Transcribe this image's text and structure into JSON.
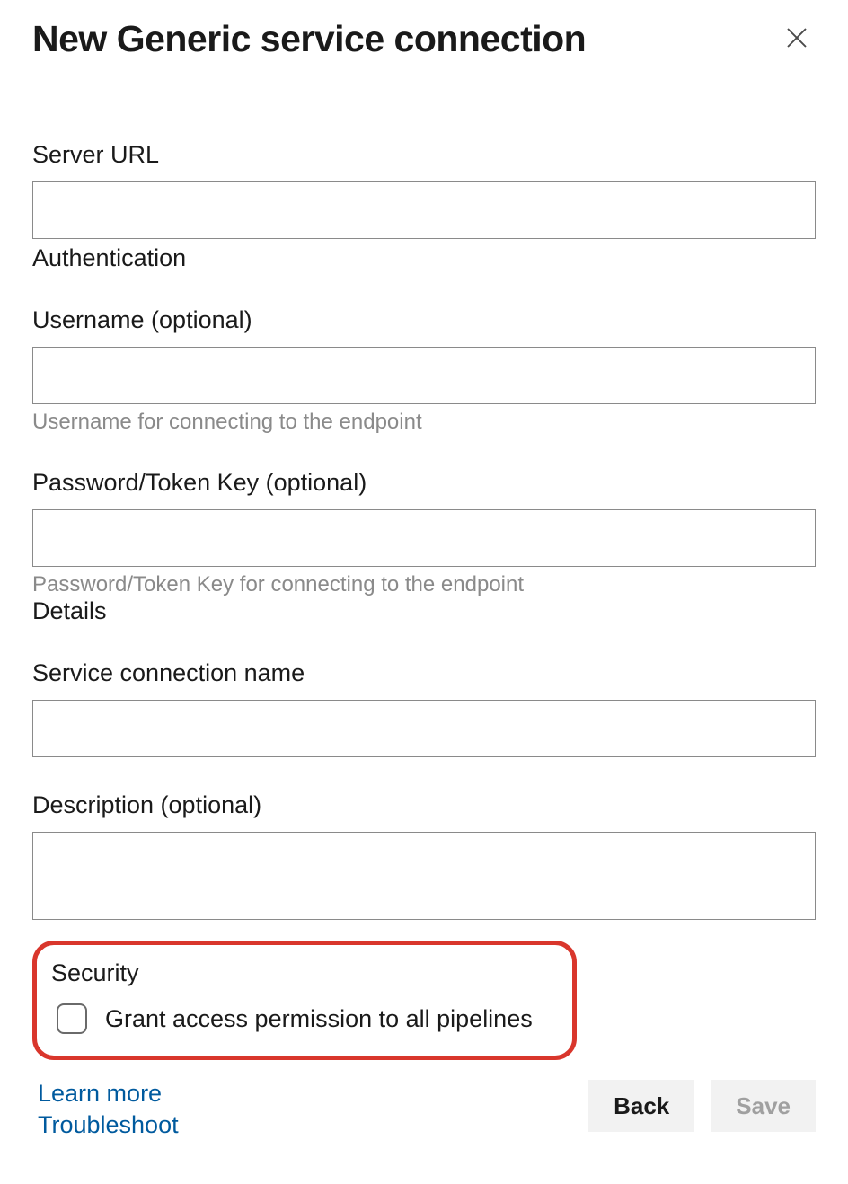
{
  "dialog": {
    "title": "New Generic service connection"
  },
  "fields": {
    "server_url": {
      "label": "Server URL",
      "value": ""
    },
    "authentication_header": "Authentication",
    "username": {
      "label": "Username (optional)",
      "value": "",
      "help": "Username for connecting to the endpoint"
    },
    "password": {
      "label": "Password/Token Key (optional)",
      "value": "",
      "help": "Password/Token Key for connecting to the endpoint"
    },
    "details_header": "Details",
    "connection_name": {
      "label": "Service connection name",
      "value": ""
    },
    "description": {
      "label": "Description (optional)",
      "value": ""
    }
  },
  "security": {
    "header": "Security",
    "checkbox_label": "Grant access permission to all pipelines",
    "checked": false
  },
  "footer": {
    "learn_more": "Learn more",
    "troubleshoot": "Troubleshoot",
    "back": "Back",
    "save": "Save"
  }
}
